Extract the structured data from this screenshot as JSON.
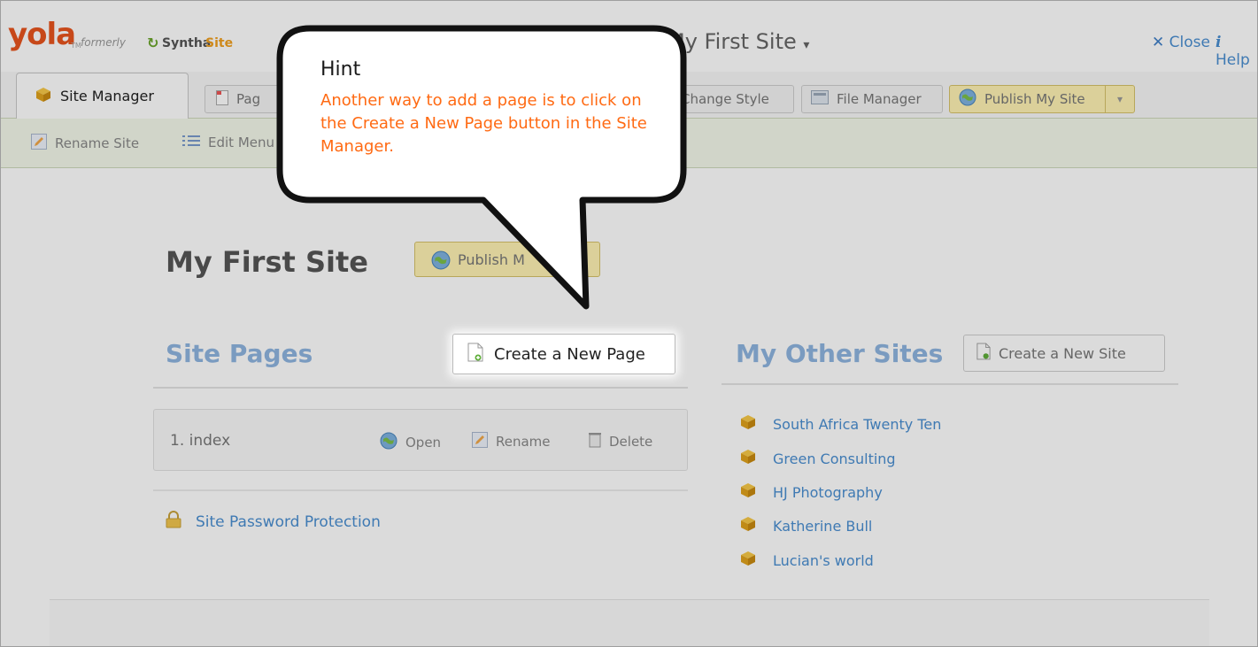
{
  "header": {
    "logo": "yola",
    "logo_tm": "TM",
    "formerly": "formerly",
    "synthasite_a": "Syntha",
    "synthasite_b": "Site",
    "site_title": "My First Site",
    "site_title_arrow": "▾",
    "close_label": "Close",
    "help_label": "Help",
    "help_arrow": "▾"
  },
  "tabs": {
    "site_manager": "Site Manager",
    "pages": "Pag",
    "change_style": "Change Style",
    "file_manager": "File Manager",
    "publish": "Publish My Site",
    "publish_arrow": "▾"
  },
  "subbar": {
    "rename_site": "Rename Site",
    "edit_menu": "Edit Menu"
  },
  "main": {
    "site_name": "My First Site",
    "publish_label": "Publish M",
    "site_pages_title": "Site Pages",
    "create_page_label": "Create a New Page",
    "pages": [
      {
        "label": "1.  index",
        "open": "Open",
        "rename": "Rename",
        "delete": "Delete"
      }
    ],
    "password_protection": "Site Password Protection",
    "other_sites_title": "My Other Sites",
    "create_site_label": "Create a New Site",
    "other_sites": [
      "South Africa Twenty Ten",
      "Green Consulting",
      "HJ Photography",
      "Katherine Bull",
      "Lucian's world"
    ]
  },
  "hint": {
    "title": "Hint",
    "body": "Another way to add a page is to click on the Create a New Page button in the Site Manager."
  },
  "colors": {
    "brand_orange": "#e8541e",
    "link_blue": "#4a8ed1",
    "hint_orange": "#ff6a13",
    "publish_yellow": "#fff3b4",
    "sub_bar_green": "#f4f9ea"
  },
  "icons": {
    "site": "cube-icon",
    "page": "page-icon",
    "publish": "globe-icon",
    "rename": "pencil-icon",
    "menu": "list-icon",
    "delete": "trash-icon",
    "lock": "lock-icon",
    "close": "x-icon",
    "help": "info-icon"
  }
}
